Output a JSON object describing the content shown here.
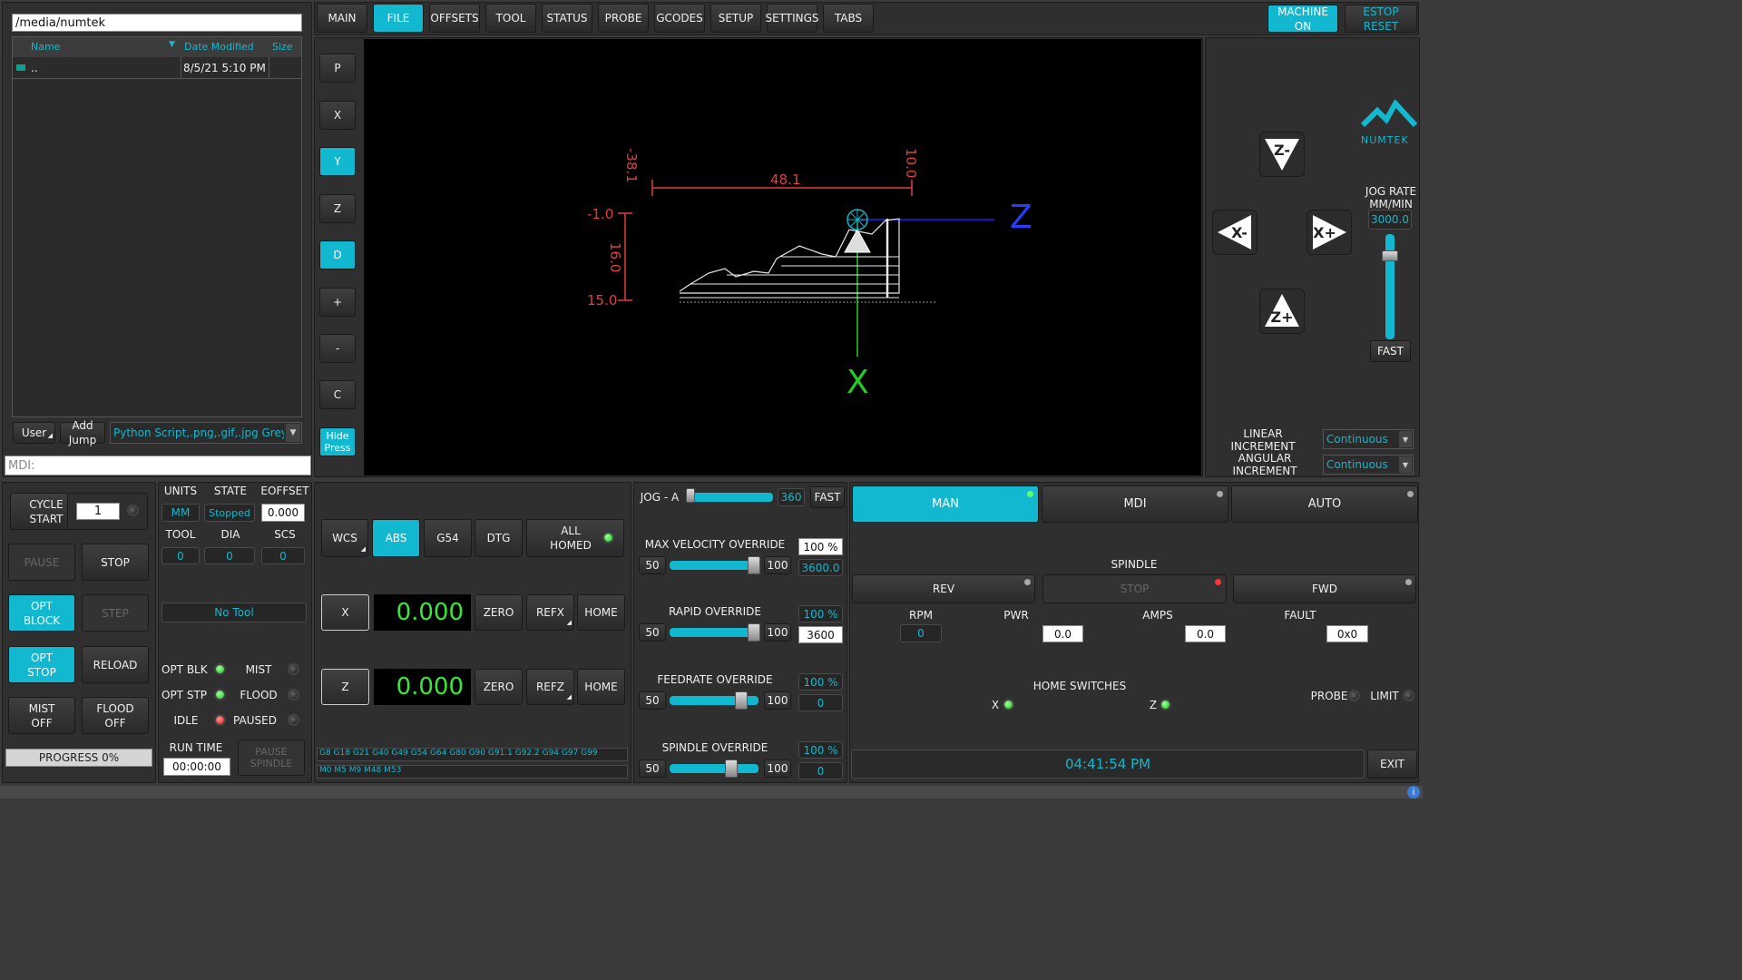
{
  "file_browser": {
    "path": "/media/numtek",
    "columns": [
      "Name",
      "Date Modified",
      "Size"
    ],
    "rows": [
      {
        "name": "..",
        "date": "8/5/21 5:10 PM",
        "size": ""
      }
    ],
    "user_button": "User",
    "add_jump_button": "Add Jump",
    "filter": "Python Script,.png,.gif,.jpg Greysca",
    "mdi_placeholder": "MDI:"
  },
  "tabs": [
    "MAIN",
    "FILE",
    "OFFSETS",
    "TOOL",
    "STATUS",
    "PROBE",
    "GCODES",
    "SETUP",
    "SETTINGS",
    "TABS"
  ],
  "active_tab": "FILE",
  "machine": {
    "machine_on": "MACHINE ON",
    "estop": "ESTOP RESET"
  },
  "view_buttons": [
    "P",
    "X",
    "Y",
    "Z",
    "D",
    "+",
    "-",
    "C",
    "Hide Press"
  ],
  "preview": {
    "dim_top": "48.1",
    "dim_top_left": "-38.1",
    "dim_top_right": "10.0",
    "dim_left_top": "-1.0",
    "dim_left_mid": "16.0",
    "dim_left_bottom": "15.0",
    "axis_z": "Z",
    "axis_x": "X"
  },
  "jog": {
    "logo": "NUMTEK",
    "rate_label": "JOG RATE MM/MIN",
    "rate_value": "3000.0",
    "fast": "FAST",
    "zminus": "Z-",
    "zplus": "Z+",
    "xminus": "X-",
    "xplus": "X+",
    "linear_label": "LINEAR INCREMENT",
    "linear_value": "Continuous",
    "angular_label": "ANGULAR INCREMENT",
    "angular_value": "Continuous"
  },
  "cycle": {
    "cycle_start": "CYCLE START",
    "cycle_value": "1",
    "pause": "PAUSE",
    "stop": "STOP",
    "opt_block": "OPT BLOCK",
    "step": "STEP",
    "opt_stop": "OPT STOP",
    "reload": "RELOAD",
    "mist_off": "MIST OFF",
    "flood_off": "FLOOD OFF",
    "progress": "PROGRESS 0%"
  },
  "status": {
    "units_label": "UNITS",
    "state_label": "STATE",
    "eoffset_label": "EOFFSET",
    "units": "MM",
    "state": "Stopped",
    "eoffset": "0.000",
    "tool_label": "TOOL",
    "dia_label": "DIA",
    "scs_label": "SCS",
    "tool": "0",
    "dia": "0",
    "scs": "0",
    "no_tool": "No Tool",
    "opt_blk": "OPT BLK",
    "mist": "MIST",
    "opt_stp": "OPT STP",
    "flood": "FLOOD",
    "idle": "IDLE",
    "paused": "PAUSED",
    "run_time_label": "RUN TIME",
    "run_time": "00:00:00",
    "pause_spindle": "PAUSE SPINDLE"
  },
  "dro": {
    "wcs": "WCS",
    "abs": "ABS",
    "g54": "G54",
    "dtg": "DTG",
    "all_homed": "ALL HOMED",
    "x_label": "X",
    "x_value": "0.000",
    "z_label": "Z",
    "z_value": "0.000",
    "zero": "ZERO",
    "refx": "REFX",
    "refz": "REFZ",
    "home": "HOME",
    "gcodes": "G8 G18 G21 G40 G49 G54 G64 G80 G90 G91.1 G92.2 G94 G97 G99",
    "mcodes": "M0 M5 M9 M48 M53"
  },
  "overrides": {
    "jog_a_label": "JOG - A",
    "jog_a_value": "360",
    "jog_fast": "FAST",
    "max_vel_label": "MAX VELOCITY OVERRIDE",
    "max_vel_pct": "100 %",
    "max_vel_value": "3600.0",
    "rapid_label": "RAPID OVERRIDE",
    "rapid_pct": "100 %",
    "rapid_value": "3600",
    "feed_label": "FEEDRATE OVERRIDE",
    "feed_pct": "100 %",
    "feed_value": "0",
    "spindle_label": "SPINDLE OVERRIDE",
    "spindle_pct": "100 %",
    "spindle_value": "0",
    "min": "50",
    "max": "100",
    "max_vel_level": 1.0,
    "rapid_level": 1.0,
    "feed_level": 0.8,
    "spindle_level": 0.7,
    "jog_a_level": 0.0
  },
  "mode": {
    "man": "MAN",
    "mdi": "MDI",
    "auto": "AUTO",
    "spindle_label": "SPINDLE",
    "rev": "REV",
    "stop": "STOP",
    "fwd": "FWD",
    "rpm_label": "RPM",
    "pwr_label": "PWR",
    "amps_label": "AMPS",
    "fault_label": "FAULT",
    "rpm": "0",
    "pwr": "0.0",
    "amps": "0.0",
    "fault": "0x0",
    "home_switches": "HOME SWITCHES",
    "x": "X",
    "z": "Z",
    "probe": "PROBE",
    "limit": "LIMIT",
    "clock": "04:41:54 PM",
    "exit": "EXIT"
  },
  "colors": {
    "accent": "#11b8cf",
    "dro_green": "#39e639"
  }
}
